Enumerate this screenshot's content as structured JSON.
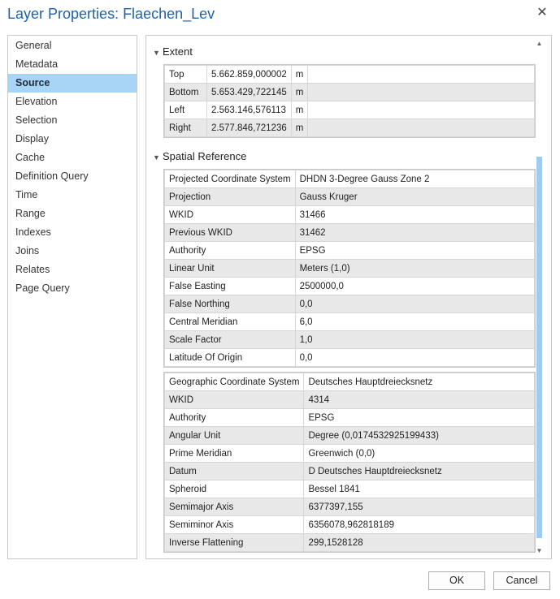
{
  "window": {
    "title": "Layer Properties: Flaechen_Lev",
    "close_glyph": "✕"
  },
  "nav": {
    "items": [
      {
        "label": "General"
      },
      {
        "label": "Metadata"
      },
      {
        "label": "Source"
      },
      {
        "label": "Elevation"
      },
      {
        "label": "Selection"
      },
      {
        "label": "Display"
      },
      {
        "label": "Cache"
      },
      {
        "label": "Definition Query"
      },
      {
        "label": "Time"
      },
      {
        "label": "Range"
      },
      {
        "label": "Indexes"
      },
      {
        "label": "Joins"
      },
      {
        "label": "Relates"
      },
      {
        "label": "Page Query"
      }
    ],
    "active_index": 2,
    "active_color": "#a8d4f5"
  },
  "extent": {
    "header": "Extent",
    "rows": [
      {
        "label": "Top",
        "value": "5.662.859,000002",
        "unit": "m"
      },
      {
        "label": "Bottom",
        "value": "5.653.429,722145",
        "unit": "m"
      },
      {
        "label": "Left",
        "value": "2.563.146,576113",
        "unit": "m"
      },
      {
        "label": "Right",
        "value": "2.577.846,721236",
        "unit": "m"
      }
    ]
  },
  "spatial_reference": {
    "header": "Spatial Reference",
    "projected": [
      {
        "label": "Projected Coordinate System",
        "value": "DHDN 3-Degree Gauss Zone 2"
      },
      {
        "label": "Projection",
        "value": "Gauss Kruger"
      },
      {
        "label": "WKID",
        "value": "31466"
      },
      {
        "label": "Previous WKID",
        "value": "31462"
      },
      {
        "label": "Authority",
        "value": "EPSG"
      },
      {
        "label": "Linear Unit",
        "value": "Meters (1,0)"
      },
      {
        "label": "False Easting",
        "value": "2500000,0"
      },
      {
        "label": "False Northing",
        "value": "0,0"
      },
      {
        "label": "Central Meridian",
        "value": "6,0"
      },
      {
        "label": "Scale Factor",
        "value": "1,0"
      },
      {
        "label": "Latitude Of Origin",
        "value": "0,0"
      }
    ],
    "geographic": [
      {
        "label": "Geographic Coordinate System",
        "value": "Deutsches Hauptdreiecksnetz"
      },
      {
        "label": "WKID",
        "value": "4314"
      },
      {
        "label": "Authority",
        "value": "EPSG"
      },
      {
        "label": "Angular Unit",
        "value": "Degree (0,0174532925199433)"
      },
      {
        "label": "Prime Meridian",
        "value": "Greenwich (0,0)"
      },
      {
        "label": "Datum",
        "value": "D Deutsches Hauptdreiecksnetz"
      },
      {
        "label": "Spheroid",
        "value": "Bessel 1841"
      },
      {
        "label": "Semimajor Axis",
        "value": "6377397,155"
      },
      {
        "label": "Semiminor Axis",
        "value": "6356078,962818189"
      },
      {
        "label": "Inverse Flattening",
        "value": "299,1528128"
      }
    ]
  },
  "buttons": {
    "ok": "OK",
    "cancel": "Cancel"
  },
  "icons": {
    "collapse": "chevron-down-icon",
    "close": "close-icon"
  },
  "scroll": {
    "thumb_color": "#9fcbef"
  }
}
